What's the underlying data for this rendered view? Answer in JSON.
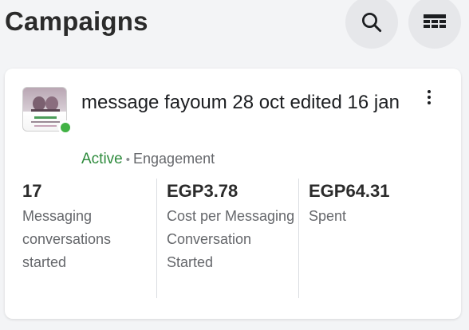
{
  "header": {
    "title": "Campaigns",
    "search_icon": "search-icon",
    "table_icon": "table-view-icon"
  },
  "campaign": {
    "name": "message fayoum 28 oct edited 16 jan",
    "status": "Active",
    "separator": "•",
    "objective": "Engagement",
    "status_color": "#41b244",
    "thumbnail_icon": "campaign-thumbnail",
    "more_icon": "more-vertical-icon",
    "metrics": [
      {
        "value": "17",
        "label": "Messaging conversations started"
      },
      {
        "value": "EGP3.78",
        "label": "Cost per Messaging Conversation Started"
      },
      {
        "value": "EGP64.31",
        "label": "Spent"
      }
    ]
  }
}
